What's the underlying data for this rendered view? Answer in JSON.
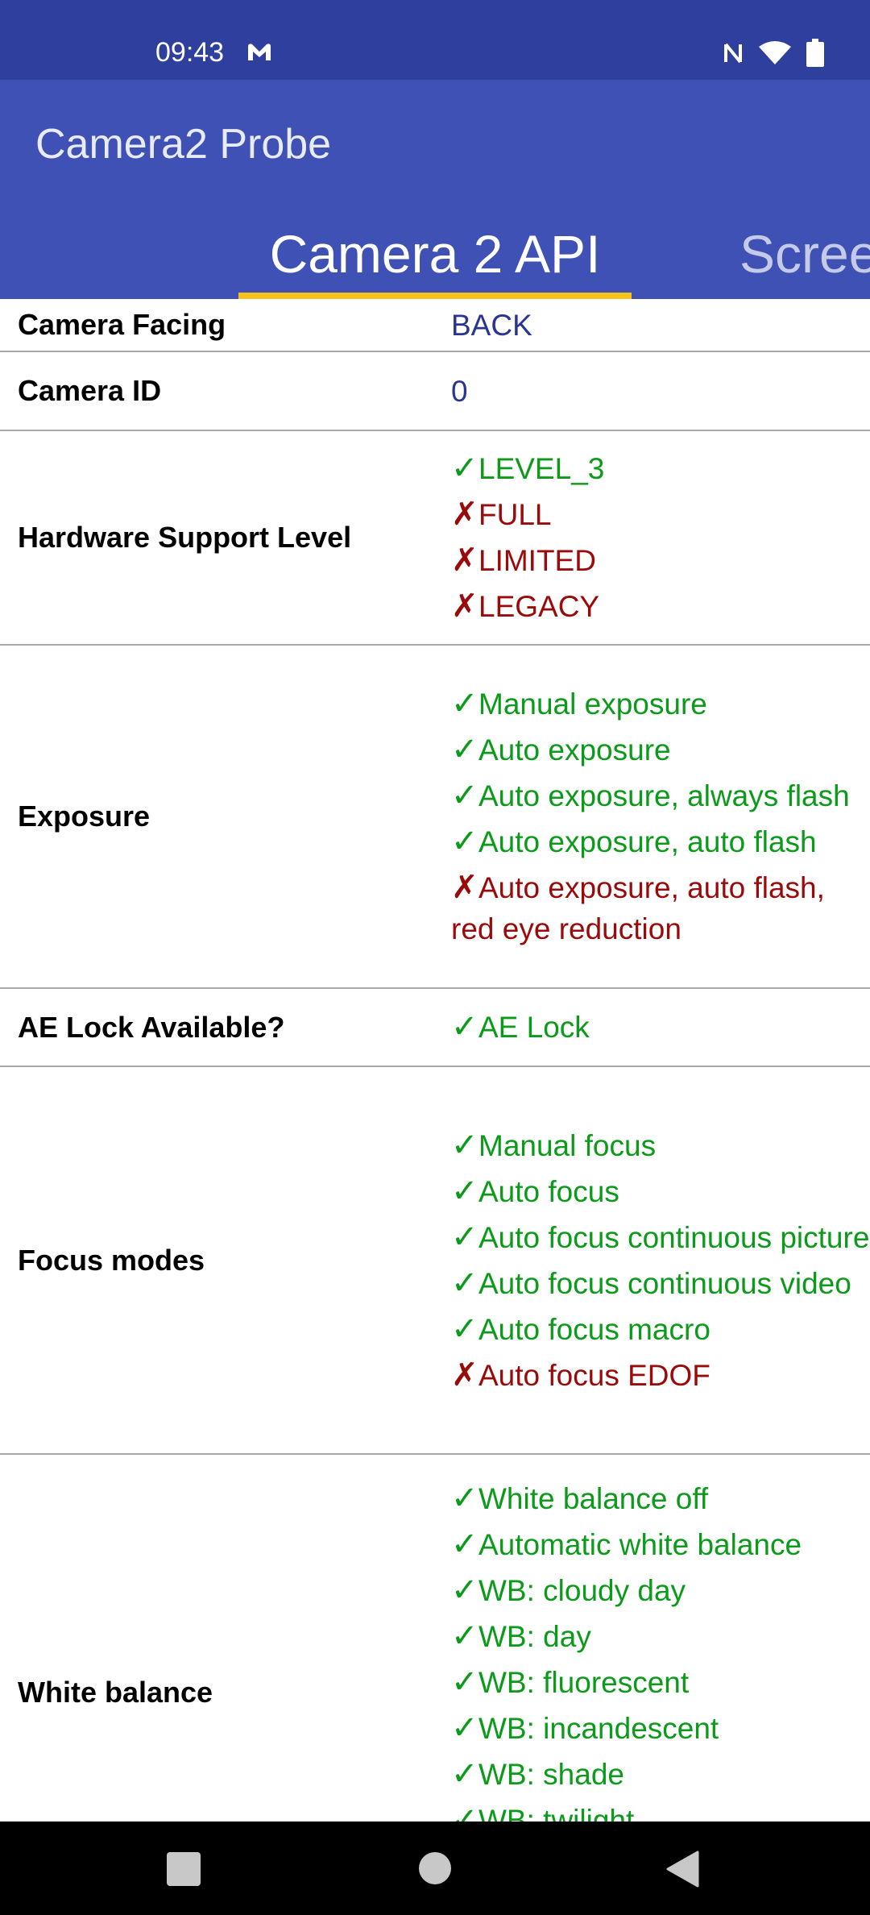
{
  "status_bar": {
    "time": "09:43"
  },
  "app_bar": {
    "title": "Camera2 Probe"
  },
  "tabs": [
    {
      "label": "Camera 2 API"
    },
    {
      "label": "Scree"
    }
  ],
  "rows": [
    {
      "label": "Camera Facing",
      "values": [
        {
          "text": "BACK",
          "state": "plain"
        }
      ]
    },
    {
      "label": "Camera ID",
      "values": [
        {
          "text": "0",
          "state": "plain"
        }
      ]
    },
    {
      "label": "Hardware Support Level",
      "values": [
        {
          "text": "LEVEL_3",
          "state": "ok"
        },
        {
          "text": "FULL",
          "state": "no"
        },
        {
          "text": "LIMITED",
          "state": "no"
        },
        {
          "text": "LEGACY",
          "state": "no"
        }
      ]
    },
    {
      "label": "Exposure",
      "values": [
        {
          "text": "Manual exposure",
          "state": "ok"
        },
        {
          "text": "Auto exposure",
          "state": "ok"
        },
        {
          "text": "Auto exposure, always flash",
          "state": "ok"
        },
        {
          "text": "Auto exposure, auto flash",
          "state": "ok"
        },
        {
          "text": "Auto exposure, auto flash, red eye reduction",
          "state": "no"
        }
      ]
    },
    {
      "label": "AE Lock Available?",
      "values": [
        {
          "text": "AE Lock",
          "state": "ok"
        }
      ]
    },
    {
      "label": "Focus modes",
      "values": [
        {
          "text": "Manual focus",
          "state": "ok"
        },
        {
          "text": "Auto focus",
          "state": "ok"
        },
        {
          "text": "Auto focus continuous picture",
          "state": "ok"
        },
        {
          "text": "Auto focus continuous video",
          "state": "ok"
        },
        {
          "text": "Auto focus macro",
          "state": "ok"
        },
        {
          "text": "Auto focus EDOF",
          "state": "no"
        }
      ]
    },
    {
      "label": "White balance",
      "values": [
        {
          "text": "White balance off",
          "state": "ok"
        },
        {
          "text": "Automatic white balance",
          "state": "ok"
        },
        {
          "text": "WB: cloudy day",
          "state": "ok"
        },
        {
          "text": "WB: day",
          "state": "ok"
        },
        {
          "text": "WB: fluorescent",
          "state": "ok"
        },
        {
          "text": "WB: incandescent",
          "state": "ok"
        },
        {
          "text": "WB: shade",
          "state": "ok"
        },
        {
          "text": "WB: twilight",
          "state": "ok"
        }
      ]
    }
  ],
  "marks": {
    "ok": "✓",
    "no": "✗"
  },
  "colors": {
    "status_bar": "#2e3f9e",
    "app_bar": "#3f51b5",
    "tab_indicator": "#f6c21b",
    "ok": "#0b9a1a",
    "no": "#9b0a0a",
    "plain": "#283593"
  },
  "icons": {
    "app_status": "mail-m-icon",
    "nfc": "nfc-icon",
    "wifi": "wifi-icon",
    "battery": "battery-icon",
    "recents": "recents-icon",
    "home": "home-icon",
    "back": "back-icon"
  }
}
